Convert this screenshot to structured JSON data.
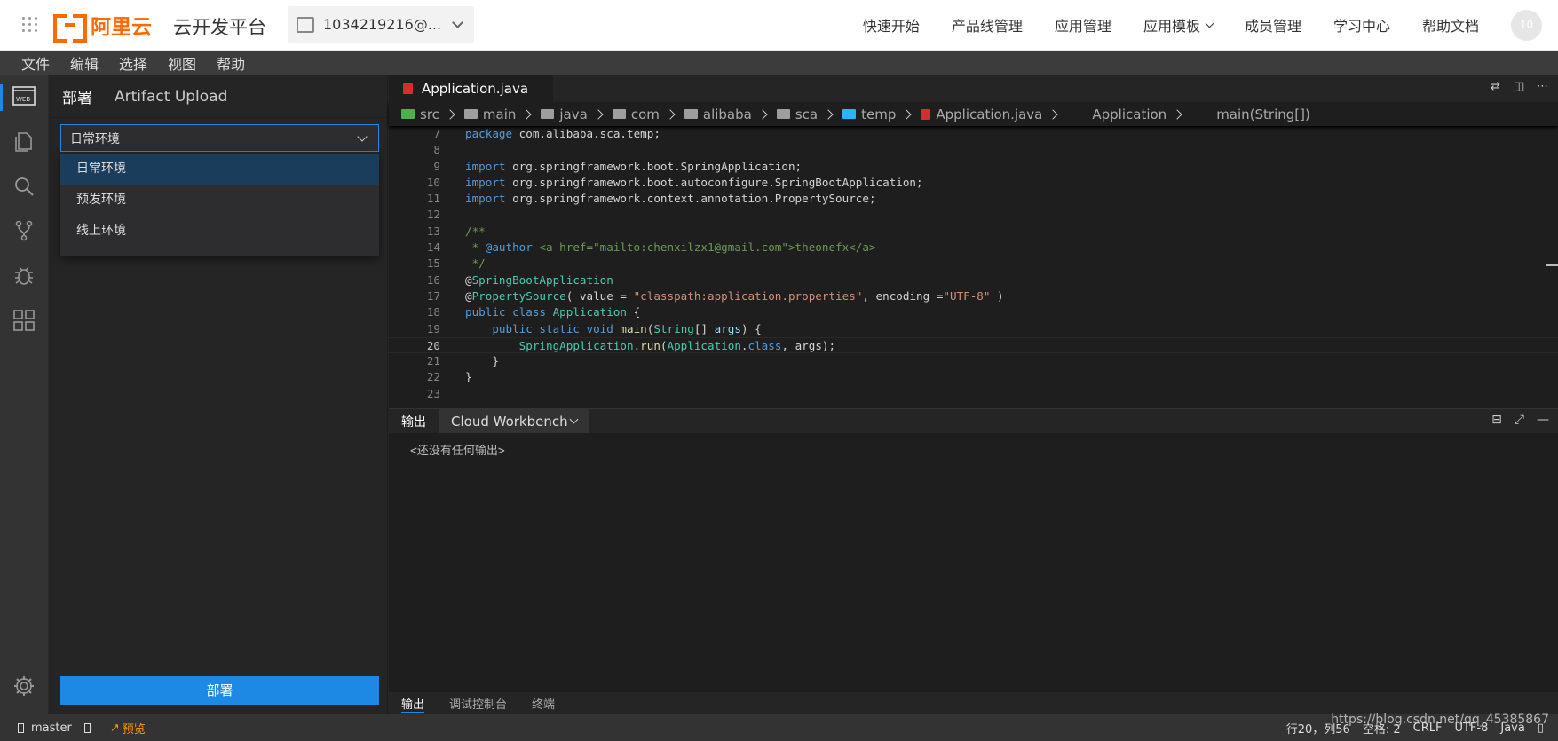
{
  "header": {
    "logo_text": "阿里云",
    "platform_title": "云开发平台",
    "account": "1034219216@...",
    "nav": [
      "快速开始",
      "产品线管理",
      "应用管理",
      "应用模板",
      "成员管理",
      "学习中心",
      "帮助文档"
    ],
    "avatar": "10"
  },
  "menubar": [
    "文件",
    "编辑",
    "选择",
    "视图",
    "帮助"
  ],
  "activity_icons": [
    "web-deploy-icon",
    "files-icon",
    "search-icon",
    "source-control-icon",
    "debug-icon",
    "extensions-icon",
    "settings-icon"
  ],
  "sidebar": {
    "tabs": [
      "部署",
      "Artifact Upload"
    ],
    "env_select": "日常环境",
    "env_options": [
      "日常环境",
      "预发环境",
      "线上环境"
    ],
    "deploy_button": "部署"
  },
  "editor": {
    "tab": "Application.java",
    "breadcrumbs": [
      "src",
      "main",
      "java",
      "com",
      "alibaba",
      "sca",
      "temp",
      "Application.java",
      "Application",
      "main(String[])"
    ],
    "lines": [
      {
        "n": "7",
        "html": "<span class='k'>package</span> <span class='id'>com.alibaba.sca.temp;</span>"
      },
      {
        "n": "8",
        "html": ""
      },
      {
        "n": "9",
        "html": "<span class='k'>import</span> <span class='id'>org.springframework.boot.SpringApplication;</span>"
      },
      {
        "n": "10",
        "html": "<span class='k'>import</span> <span class='id'>org.springframework.boot.autoconfigure.SpringBootApplication;</span>"
      },
      {
        "n": "11",
        "html": "<span class='k'>import</span> <span class='id'>org.springframework.context.annotation.PropertySource;</span>"
      },
      {
        "n": "12",
        "html": ""
      },
      {
        "n": "13",
        "html": "<span class='cm'>/**</span>"
      },
      {
        "n": "14",
        "html": "<span class='cm'> * </span><span class='k'>@author</span><span class='cm'> &lt;a href=\"mailto:chenxilzx1@gmail.com\"&gt;theonefx&lt;/a&gt;</span>"
      },
      {
        "n": "15",
        "html": "<span class='cm'> */</span>"
      },
      {
        "n": "16",
        "html": "<span class='id'>@</span><span class='an'>SpringBootApplication</span>"
      },
      {
        "n": "17",
        "html": "<span class='id'>@</span><span class='an'>PropertySource</span><span class='id'>( value = </span><span class='s'>\"classpath:application.properties\"</span><span class='id'>, encoding =</span><span class='s'>\"UTF-8\"</span><span class='id'> )</span>"
      },
      {
        "n": "18",
        "html": "<span class='k'>public class</span> <span class='ty'>Application</span> <span class='id'>{</span>"
      },
      {
        "n": "19",
        "html": "<span class='id'>    </span><span class='k'>public static void</span> <span class='fn'>main</span><span class='id'>(</span><span class='ty'>String</span><span class='id'>[] </span><span class='pm'>args</span><span class='id'>) {</span>"
      },
      {
        "n": "20",
        "html": "<span class='id'>        </span><span class='ty'>SpringApplication</span><span class='id'>.</span><span class='fn'>run</span><span class='id'>(</span><span class='ty'>Application</span><span class='id'>.</span><span class='k'>class</span><span class='id'>, args);</span>"
      },
      {
        "n": "21",
        "html": "<span class='id'>    }</span>"
      },
      {
        "n": "22",
        "html": "<span class='id'>}</span>"
      },
      {
        "n": "23",
        "html": ""
      }
    ],
    "current_line": "20"
  },
  "panel": {
    "label": "输出",
    "channel": "Cloud Workbench",
    "empty_text": "<还没有任何输出>",
    "bottom_tabs": [
      "输出",
      "调试控制台",
      "终端"
    ]
  },
  "status": {
    "branch": "master",
    "preview": "预览",
    "position": "行20，列56",
    "indent": "空格: 2",
    "eol": "CRLF",
    "encoding": "UTF-8",
    "language": "Java"
  },
  "watermark": "https://blog.csdn.net/qq_45385867"
}
